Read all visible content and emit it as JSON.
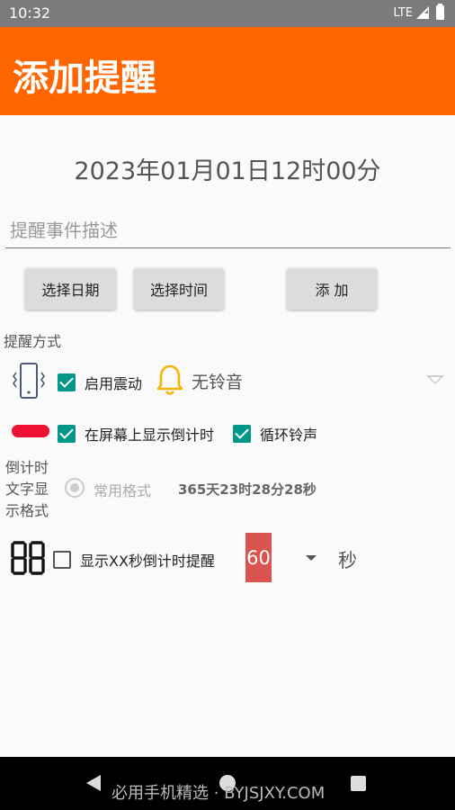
{
  "status_bar": {
    "time": "10:32",
    "network": "LTE"
  },
  "app_bar": {
    "title": "添加提醒"
  },
  "datetime_display": "2023年01月01日12时00分",
  "description": {
    "placeholder": "提醒事件描述",
    "value": ""
  },
  "buttons": {
    "select_date": "选择日期",
    "select_time": "选择时间",
    "add": "添 加"
  },
  "reminder_method": {
    "label": "提醒方式",
    "vibrate": {
      "label": "启用震动",
      "checked": true
    },
    "ringtone": {
      "label": "无铃音"
    },
    "show_countdown": {
      "label": "在屏幕上显示倒计时",
      "checked": true
    },
    "loop_ringtone": {
      "label": "循环铃声",
      "checked": true
    }
  },
  "countdown_format": {
    "label": "倒计时文字显示格式",
    "option": "常用格式",
    "sample": "365天23时28分28秒"
  },
  "xx_seconds": {
    "label": "显示XX秒倒计时提醒",
    "checked": false,
    "value": "60",
    "unit": "秒"
  },
  "nav_bar": {
    "watermark": "必用手机精选 · BYJSJXY.COM"
  },
  "colors": {
    "accent": "#ff6600",
    "checkbox": "#009688",
    "number_box": "#d9534f",
    "pill": "#ee1133",
    "bell": "#f5b400"
  },
  "icons": [
    "signal-icon",
    "battery-icon",
    "phone-vibrate-icon",
    "bell-icon",
    "chevron-down-icon",
    "pill-indicator-icon",
    "seven-segment-icon"
  ]
}
